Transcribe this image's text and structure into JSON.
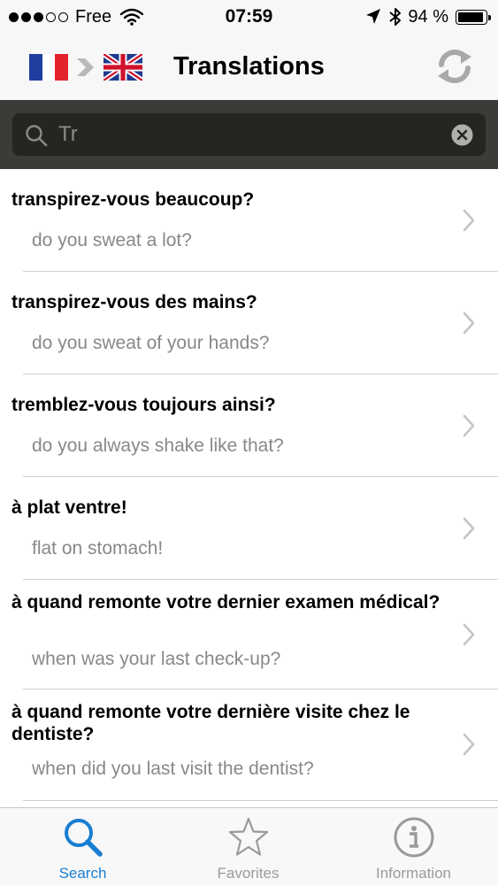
{
  "status_bar": {
    "carrier": "Free",
    "time": "07:59",
    "battery_percent": "94 %",
    "battery_level": 0.94
  },
  "nav_bar": {
    "title": "Translations",
    "source_language_icon": "french-flag-icon",
    "target_language_icon": "uk-flag-icon",
    "swap_icon": "swap-languages-icon"
  },
  "search": {
    "value": "Tr"
  },
  "results": [
    {
      "fr": "transpirez-vous beaucoup?",
      "en": "do you sweat a lot?"
    },
    {
      "fr": "transpirez-vous des mains?",
      "en": "do you sweat of your hands?"
    },
    {
      "fr": "tremblez-vous toujours ainsi?",
      "en": "do you always shake like that?"
    },
    {
      "fr": "à plat ventre!",
      "en": "flat on stomach!"
    },
    {
      "fr": "à quand remonte votre dernier examen médical?",
      "en": "when was your last check-up?"
    },
    {
      "fr": "à quand remonte votre dernière visite chez le dentiste?",
      "en": "when did you last visit the dentist?"
    }
  ],
  "tab_bar": {
    "tabs": [
      {
        "label": "Search",
        "icon": "search-icon",
        "active": true
      },
      {
        "label": "Favorites",
        "icon": "star-icon",
        "active": false
      },
      {
        "label": "Information",
        "icon": "info-icon",
        "active": false
      }
    ]
  },
  "colors": {
    "accent": "#1a7ed1",
    "inactive_tab": "#9a9a9a",
    "search_background": "#3c3b37",
    "search_field": "#262522"
  }
}
